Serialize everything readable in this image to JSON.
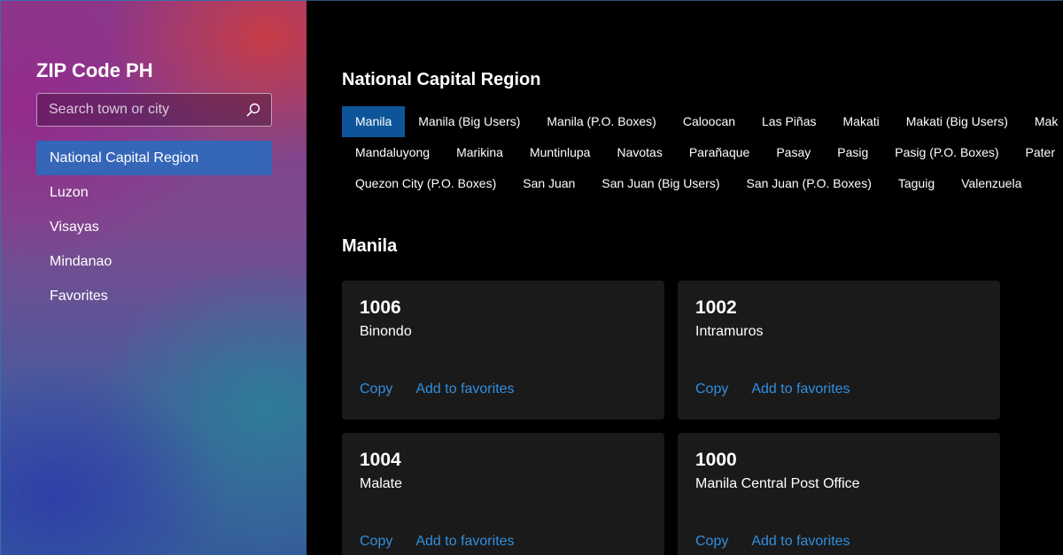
{
  "app": {
    "title": "ZIP Code PH"
  },
  "search": {
    "placeholder": "Search town or city",
    "value": ""
  },
  "sidebar": {
    "items": [
      {
        "label": "National Capital Region",
        "active": true
      },
      {
        "label": "Luzon",
        "active": false
      },
      {
        "label": "Visayas",
        "active": false
      },
      {
        "label": "Mindanao",
        "active": false
      },
      {
        "label": "Favorites",
        "active": false
      }
    ]
  },
  "region": {
    "title": "National Capital Region",
    "chip_rows": [
      [
        "Manila",
        "Manila (Big Users)",
        "Manila (P.O. Boxes)",
        "Caloocan",
        "Las Piñas",
        "Makati",
        "Makati (Big Users)",
        "Mak"
      ],
      [
        "Mandaluyong",
        "Marikina",
        "Muntinlupa",
        "Navotas",
        "Parañaque",
        "Pasay",
        "Pasig",
        "Pasig (P.O. Boxes)",
        "Pater"
      ],
      [
        "Quezon City (P.O. Boxes)",
        "San Juan",
        "San Juan (Big Users)",
        "San Juan (P.O. Boxes)",
        "Taguig",
        "Valenzuela"
      ]
    ],
    "active_chip": "Manila"
  },
  "city": {
    "title": "Manila",
    "cards": [
      {
        "zip": "1006",
        "place": "Binondo",
        "copy_label": "Copy",
        "fav_label": "Add to favorites"
      },
      {
        "zip": "1002",
        "place": "Intramuros",
        "copy_label": "Copy",
        "fav_label": "Add to favorites"
      },
      {
        "zip": "1004",
        "place": "Malate",
        "copy_label": "Copy",
        "fav_label": "Add to favorites"
      },
      {
        "zip": "1000",
        "place": "Manila Central Post Office",
        "copy_label": "Copy",
        "fav_label": "Add to favorites"
      }
    ]
  },
  "colors": {
    "accent": "#3566b8",
    "chip_active": "#0d5598",
    "link": "#2f8fe0",
    "card_bg": "#1a1a1a"
  }
}
